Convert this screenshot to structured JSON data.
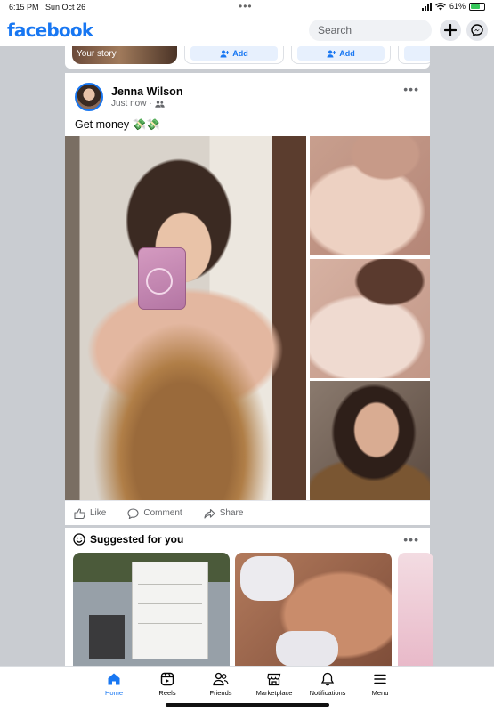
{
  "status_bar": {
    "time": "6:15 PM",
    "date": "Sun Oct 26",
    "dots": "•••",
    "battery": "61%",
    "battery_level": 0.61
  },
  "header": {
    "logo": "facebook",
    "search_placeholder": "Search"
  },
  "stories": {
    "your_story": "Your story",
    "add_labels": [
      "Add",
      "Add"
    ]
  },
  "post": {
    "author": "Jenna Wilson",
    "time": "Just now ·",
    "text": "Get money 💸💸",
    "actions": {
      "like": "Like",
      "comment": "Comment",
      "share": "Share"
    }
  },
  "suggested": {
    "title": "Suggested for you"
  },
  "nav": {
    "items": [
      {
        "label": "Home",
        "icon": "home-icon",
        "active": true
      },
      {
        "label": "Reels",
        "icon": "reels-icon"
      },
      {
        "label": "Friends",
        "icon": "friends-icon"
      },
      {
        "label": "Marketplace",
        "icon": "marketplace-icon"
      },
      {
        "label": "Notifications",
        "icon": "bell-icon"
      },
      {
        "label": "Menu",
        "icon": "menu-icon"
      }
    ]
  },
  "colors": {
    "brand": "#1877f2",
    "background": "#c9ccd1",
    "secondary_text": "#65676b"
  }
}
